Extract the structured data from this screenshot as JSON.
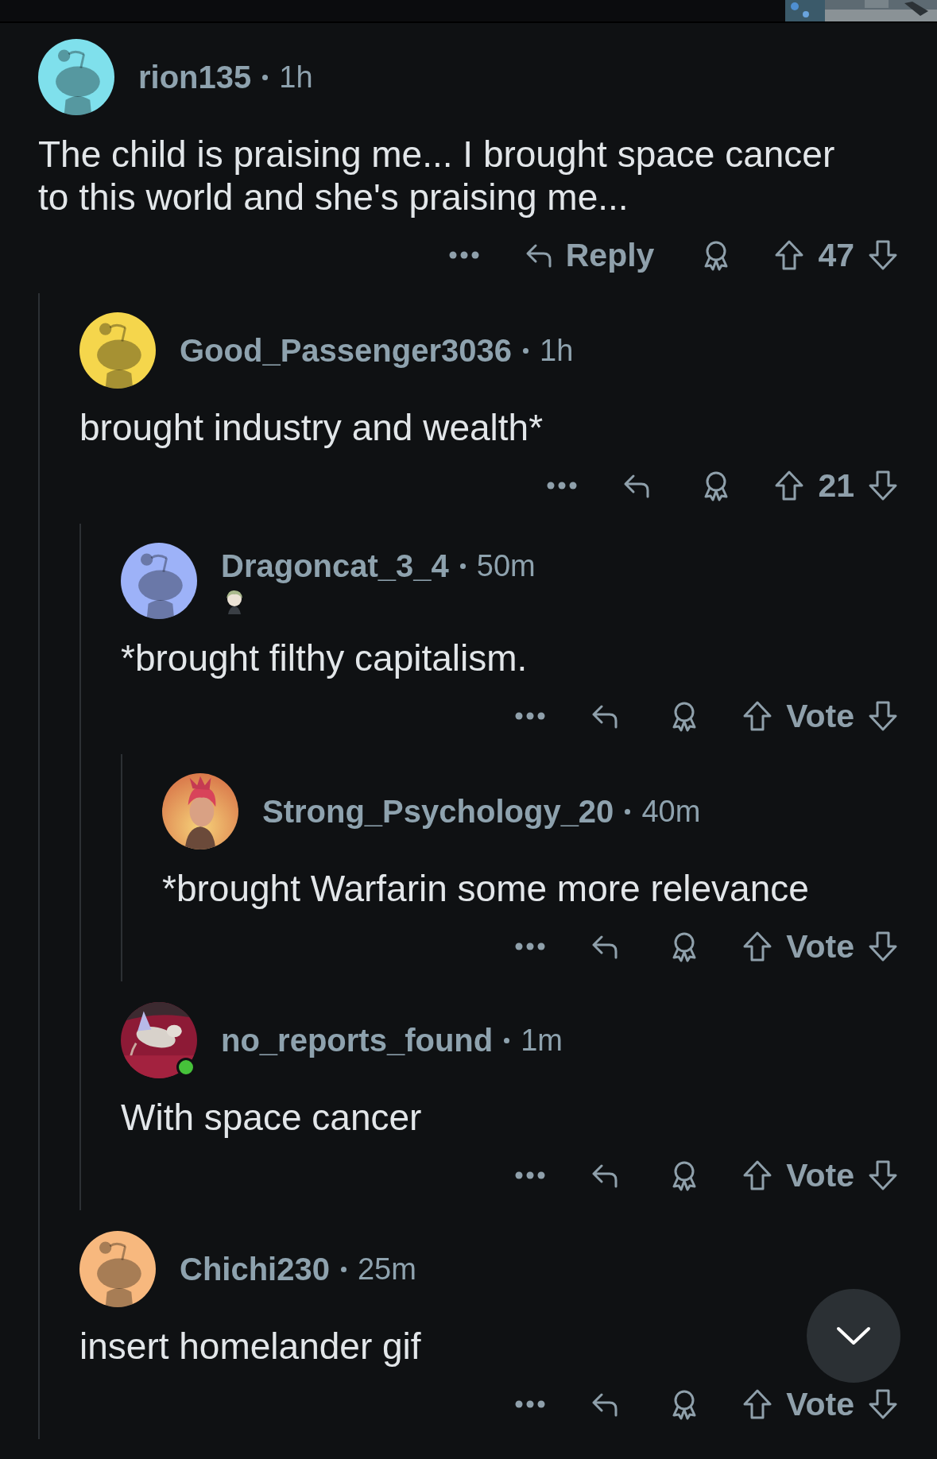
{
  "header_strip": {
    "kind": "picture"
  },
  "comments": [
    {
      "avatar": {
        "kind": "snoo",
        "color": "#7fe0ec"
      },
      "online": false,
      "username": "rion135",
      "time": "1h",
      "body": "The child is praising me... I brought space cancer to this world and she's praising me...",
      "reply_label": "Reply",
      "vote_label": "47",
      "children": [
        {
          "avatar": {
            "kind": "snoo",
            "color": "#f5d64c"
          },
          "online": false,
          "username": "Good_Passenger3036",
          "time": "1h",
          "body": "brought industry and wealth*",
          "vote_label": "21",
          "children": [
            {
              "avatar": {
                "kind": "snoo",
                "color": "#9db2f8"
              },
              "online": false,
              "username": "Dragoncat_3_4",
              "time": "50m",
              "flair": {
                "kind": "picture"
              },
              "body": "*brought filthy capitalism.",
              "vote_label": "Vote",
              "children": [
                {
                  "avatar": {
                    "kind": "picture"
                  },
                  "online": false,
                  "username": "Strong_Psychology_20",
                  "time": "40m",
                  "body": "*brought Warfarin some more relevance",
                  "vote_label": "Vote"
                }
              ]
            },
            {
              "avatar": {
                "kind": "picture"
              },
              "online": true,
              "username": "no_reports_found",
              "time": "1m",
              "body": "With space cancer",
              "vote_label": "Vote"
            }
          ]
        },
        {
          "avatar": {
            "kind": "snoo",
            "color": "#f7b87e"
          },
          "online": false,
          "username": "Chichi230",
          "time": "25m",
          "body": "insert homelander gif",
          "vote_label": "Vote"
        }
      ]
    }
  ]
}
